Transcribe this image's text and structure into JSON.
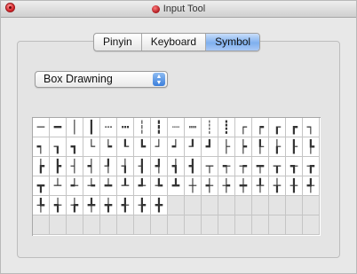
{
  "window": {
    "title": "Input Tool"
  },
  "tabs": [
    {
      "label": "Pinyin",
      "selected": false
    },
    {
      "label": "Keyboard",
      "selected": false
    },
    {
      "label": "Symbol",
      "selected": true
    }
  ],
  "category_popup": {
    "value": "Box Drawning"
  },
  "symbols": [
    "─",
    "━",
    "│",
    "┃",
    "┄",
    "┅",
    "┆",
    "┇",
    "┈",
    "┉",
    "┊",
    "┋",
    "┌",
    "┍",
    "┎",
    "┏",
    "┐",
    "┑",
    "┒",
    "┓",
    "└",
    "┕",
    "┖",
    "┗",
    "┘",
    "┙",
    "┚",
    "┛",
    "├",
    "┝",
    "┞",
    "┟",
    "┠",
    "┡",
    "┢",
    "┣",
    "┤",
    "┥",
    "┦",
    "┧",
    "┨",
    "┩",
    "┪",
    "┫",
    "┬",
    "┭",
    "┮",
    "┯",
    "┰",
    "┱",
    "┲",
    "┳",
    "┴",
    "┵",
    "┶",
    "┷",
    "┸",
    "┹",
    "┺",
    "┻",
    "┼",
    "┽",
    "┾",
    "┿",
    "╀",
    "╁",
    "╂",
    "╃",
    "╄",
    "╅",
    "╆",
    "╇",
    "╈",
    "╉",
    "╊",
    "╋"
  ],
  "colors": {
    "selected_tab": "#7fb0ef",
    "close_button": "#d9292e"
  }
}
